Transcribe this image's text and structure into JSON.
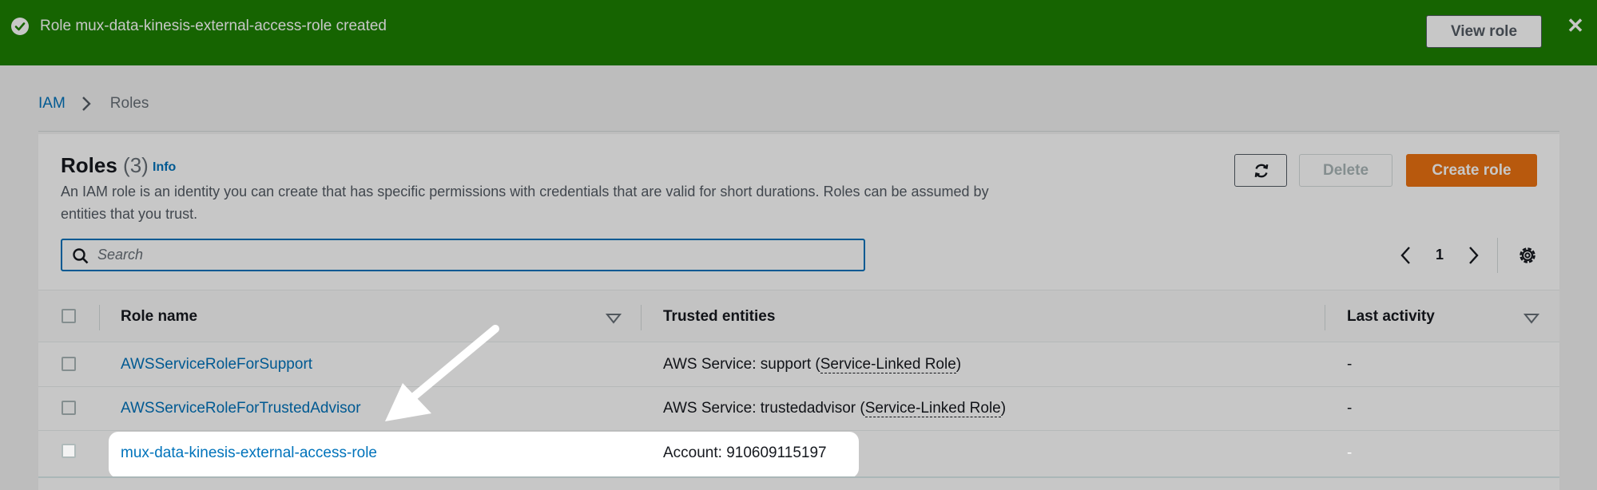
{
  "banner": {
    "message": "Role mux-data-kinesis-external-access-role created",
    "view_role_label": "View role",
    "close_glyph": "✕",
    "status_icon": "check-circle-icon"
  },
  "breadcrumb": {
    "root": "IAM",
    "current": "Roles"
  },
  "roles_panel": {
    "title": "Roles",
    "count": "(3)",
    "info_label": "Info",
    "description": "An IAM role is an identity you can create that has specific permissions with credentials that are valid for short durations. Roles can be assumed by entities that you trust.",
    "delete_label": "Delete",
    "create_label": "Create role",
    "refresh_icon": "refresh-icon"
  },
  "search": {
    "placeholder": "Search",
    "value": ""
  },
  "pagination": {
    "current_page": "1"
  },
  "table": {
    "columns": [
      "Role name",
      "Trusted entities",
      "Last activity"
    ],
    "rows": [
      {
        "role_name": "AWSServiceRoleForSupport",
        "trusted_prefix": "AWS Service: support (",
        "trusted_link": "Service-Linked Role",
        "trusted_suffix": ")",
        "last_activity": "-"
      },
      {
        "role_name": "AWSServiceRoleForTrustedAdvisor",
        "trusted_prefix": "AWS Service: trustedadvisor (",
        "trusted_link": "Service-Linked Role",
        "trusted_suffix": ")",
        "last_activity": "-"
      },
      {
        "role_name": "mux-data-kinesis-external-access-role",
        "trusted_entities": "Account: 910609115197",
        "last_activity": "-"
      }
    ]
  },
  "colors": {
    "banner_green": "#1d8102",
    "link_blue": "#0073bb",
    "primary_orange": "#ec7211"
  }
}
